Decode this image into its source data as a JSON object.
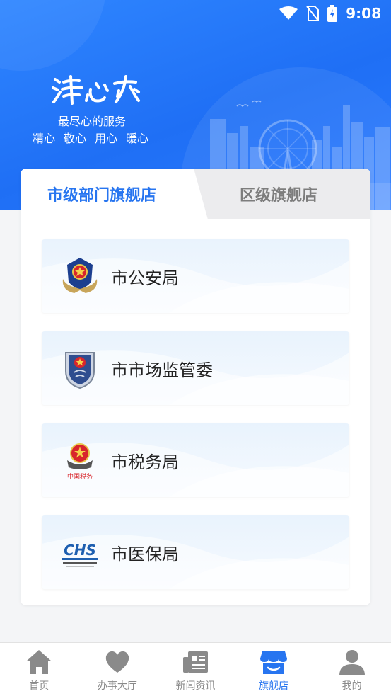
{
  "status_bar": {
    "time": "9:08"
  },
  "header": {
    "logo_text": "津心办",
    "slogan": "最尽心的服务",
    "tags": [
      "精心",
      "敬心",
      "用心",
      "暖心"
    ]
  },
  "tabs": {
    "active": "市级部门旗舰店",
    "inactive": "区级旗舰店"
  },
  "departments": [
    {
      "name": "市公安局",
      "icon": "police-emblem-icon"
    },
    {
      "name": "市市场监管委",
      "icon": "market-regulation-emblem-icon"
    },
    {
      "name": "市税务局",
      "icon": "tax-emblem-icon",
      "icon_caption": "中国税务"
    },
    {
      "name": "市医保局",
      "icon": "chs-logo-icon",
      "icon_caption": "CHS"
    }
  ],
  "bottom_nav": [
    {
      "label": "首页",
      "icon": "home-icon",
      "active": false
    },
    {
      "label": "办事大厅",
      "icon": "heart-icon",
      "active": false
    },
    {
      "label": "新闻资讯",
      "icon": "news-icon",
      "active": false
    },
    {
      "label": "旗舰店",
      "icon": "store-icon",
      "active": true
    },
    {
      "label": "我的",
      "icon": "user-icon",
      "active": false
    }
  ],
  "colors": {
    "accent": "#2775f0",
    "header_bg": "#1f6ff5",
    "inactive_nav": "#8a8a8a"
  }
}
